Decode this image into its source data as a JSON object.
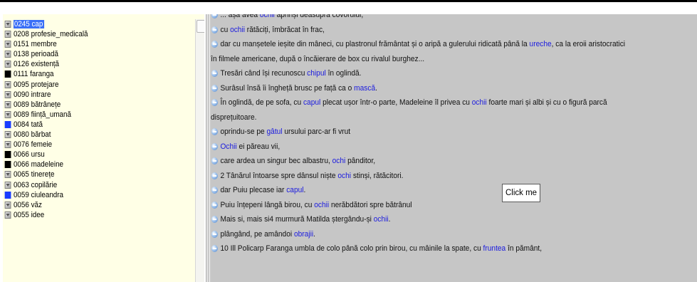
{
  "category_list": {
    "items": [
      {
        "label": "0245 cap",
        "swatch": "gray",
        "selected": true
      },
      {
        "label": "0208 profesie_medicală",
        "swatch": "gray"
      },
      {
        "label": "0151 membre",
        "swatch": "gray"
      },
      {
        "label": "0138 perioadă",
        "swatch": "gray"
      },
      {
        "label": "0126 existență",
        "swatch": "gray"
      },
      {
        "label": "0111 faranga",
        "swatch": "#000000"
      },
      {
        "label": "0095 protejare",
        "swatch": "gray"
      },
      {
        "label": "0090 intrare",
        "swatch": "gray"
      },
      {
        "label": "0089 bătrânețe",
        "swatch": "gray"
      },
      {
        "label": "0089 ființă_umană",
        "swatch": "gray"
      },
      {
        "label": "0084 tată",
        "swatch": "#1a3cff"
      },
      {
        "label": "0080 bărbat",
        "swatch": "gray"
      },
      {
        "label": "0076 femeie",
        "swatch": "gray"
      },
      {
        "label": "0066 ursu",
        "swatch": "#000000"
      },
      {
        "label": "0066 madeleine",
        "swatch": "#000000"
      },
      {
        "label": "0065 tinerețe",
        "swatch": "gray"
      },
      {
        "label": "0063 copilărie",
        "swatch": "gray"
      },
      {
        "label": "0059 ciuleandra",
        "swatch": "#1a3cff"
      },
      {
        "label": "0056 văz",
        "swatch": "gray"
      },
      {
        "label": "0055 idee",
        "swatch": "gray"
      }
    ]
  },
  "text_lines": [
    {
      "bullet": true,
      "segments": [
        {
          "t": "... așa avea "
        },
        {
          "t": "ochii",
          "kw": true
        },
        {
          "t": " aprinși deasupra covorului,"
        }
      ]
    },
    {
      "bullet": true,
      "segments": [
        {
          "t": "cu "
        },
        {
          "t": "ochii",
          "kw": true
        },
        {
          "t": " rătăciți, îmbrăcat în frac,"
        }
      ]
    },
    {
      "bullet": true,
      "segments": [
        {
          "t": "dar cu manșetele ieșite din mâneci, cu plastronul frământat și o aripă a gulerului ridicată până la "
        },
        {
          "t": "ureche",
          "kw": true
        },
        {
          "t": ", ca la eroii aristocratici"
        }
      ]
    },
    {
      "bullet": false,
      "segments": [
        {
          "t": "în filmele americane, după o încăierare de box cu rivalul burghez..."
        }
      ]
    },
    {
      "bullet": true,
      "segments": [
        {
          "t": "Tresări când își recunoscu "
        },
        {
          "t": "chipul",
          "kw": true
        },
        {
          "t": " în oglindă."
        }
      ]
    },
    {
      "bullet": true,
      "segments": [
        {
          "t": "Surâsul însă îi îngheță brusc pe față ca o "
        },
        {
          "t": "mască",
          "kw": true
        },
        {
          "t": "."
        }
      ]
    },
    {
      "bullet": true,
      "segments": [
        {
          "t": "În oglindă, de pe sofa, cu "
        },
        {
          "t": "capul",
          "kw": true
        },
        {
          "t": " plecat ușor într-o parte, Madeleine îl privea cu "
        },
        {
          "t": "ochii",
          "kw": true
        },
        {
          "t": " foarte mari și albi și cu o figură parcă"
        }
      ]
    },
    {
      "bullet": false,
      "segments": [
        {
          "t": "disprețuitoare."
        }
      ]
    },
    {
      "bullet": true,
      "segments": [
        {
          "t": "oprindu-se pe "
        },
        {
          "t": "gâtul",
          "kw": true
        },
        {
          "t": " ursului parc-ar fi vrut"
        }
      ]
    },
    {
      "bullet": true,
      "segments": [
        {
          "t": "Ochii",
          "kw": true
        },
        {
          "t": " ei păreau vii,"
        }
      ]
    },
    {
      "bullet": true,
      "segments": [
        {
          "t": "care ardea un singur bec albastru, "
        },
        {
          "t": "ochi",
          "kw": true
        },
        {
          "t": " pânditor,"
        }
      ]
    },
    {
      "bullet": true,
      "segments": [
        {
          "t": "2 Tânărul întoarse spre dânsul niște "
        },
        {
          "t": "ochi",
          "kw": true
        },
        {
          "t": " stinși, rătăcitori."
        }
      ]
    },
    {
      "bullet": true,
      "segments": [
        {
          "t": "dar Puiu plecase iar "
        },
        {
          "t": "capul",
          "kw": true
        },
        {
          "t": "."
        }
      ]
    },
    {
      "bullet": true,
      "segments": [
        {
          "t": "Puiu înțepeni lângă birou, cu "
        },
        {
          "t": "ochii",
          "kw": true
        },
        {
          "t": " nerăbdători spre bătrânul"
        }
      ]
    },
    {
      "bullet": true,
      "segments": [
        {
          "t": "Mais si, mais si4 murmură Matilda ștergându-și "
        },
        {
          "t": "ochii",
          "kw": true
        },
        {
          "t": "."
        }
      ]
    },
    {
      "bullet": true,
      "segments": [
        {
          "t": "plângând, pe amândoi "
        },
        {
          "t": "obrajii",
          "kw": true
        },
        {
          "t": "."
        }
      ]
    },
    {
      "bullet": true,
      "segments": [
        {
          "t": "10 Ill Policarp Faranga umbla de colo până colo prin birou, cu mâinile la spate, cu "
        },
        {
          "t": "fruntea",
          "kw": true
        },
        {
          "t": " în pământ,"
        }
      ]
    }
  ],
  "tooltip": {
    "label": "Click me"
  },
  "colors": {
    "keyword": "#1a1adf",
    "selection": "#3a6ff7",
    "list_background": "#ffffe6",
    "text_background": "#c6c6c6"
  },
  "icons": {
    "list_marker": "dropdown-marker-icon",
    "line_bullet": "blue-bullet-icon"
  }
}
